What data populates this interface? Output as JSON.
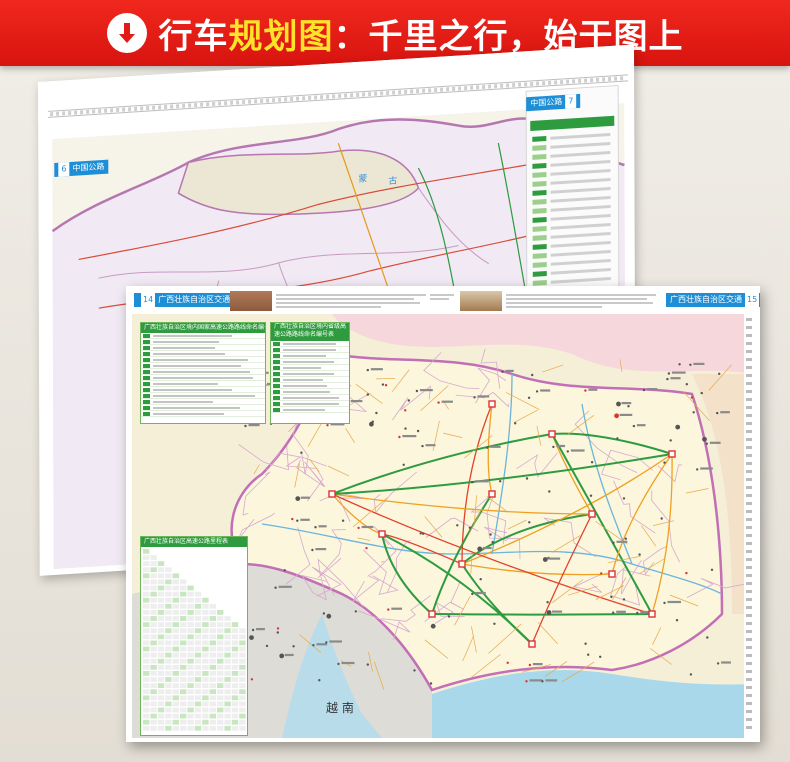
{
  "banner": {
    "title_prefix": "行车",
    "title_highlight": "规划图",
    "title_suffix": "：千里之行，始于图上",
    "icon": "arrow-down-circle-icon",
    "background_color": "#e01c14",
    "highlight_color": "#ffe22a"
  },
  "back_map": {
    "tag_left": "中国公路",
    "tag_left_page": "6",
    "tag_right": "中国公路",
    "tag_right_page": "7"
  },
  "front_map": {
    "tag_left": "广西壮族自治区交通",
    "tag_left_page": "14",
    "tag_right": "广西壮族自治区交通",
    "tag_right_page": "15",
    "table1_title": "广西壮族自治区境内国家高速公路路线命名编号表",
    "table2_title": "广西壮族自治区境内省级高速公路路线命名编号表",
    "table3_title": "广西壮族自治区高速公路里程表",
    "country_label": "越  南"
  },
  "colors": {
    "sea": "#a8d8ea",
    "land": "#f7f4d8",
    "neighbor_land": "#ede7d3",
    "border": "#c26fb5",
    "expressway": "#2d9b3f",
    "national_road": "#e2422c",
    "provincial_road": "#f0a020",
    "tag_blue": "#1e8fd6"
  }
}
